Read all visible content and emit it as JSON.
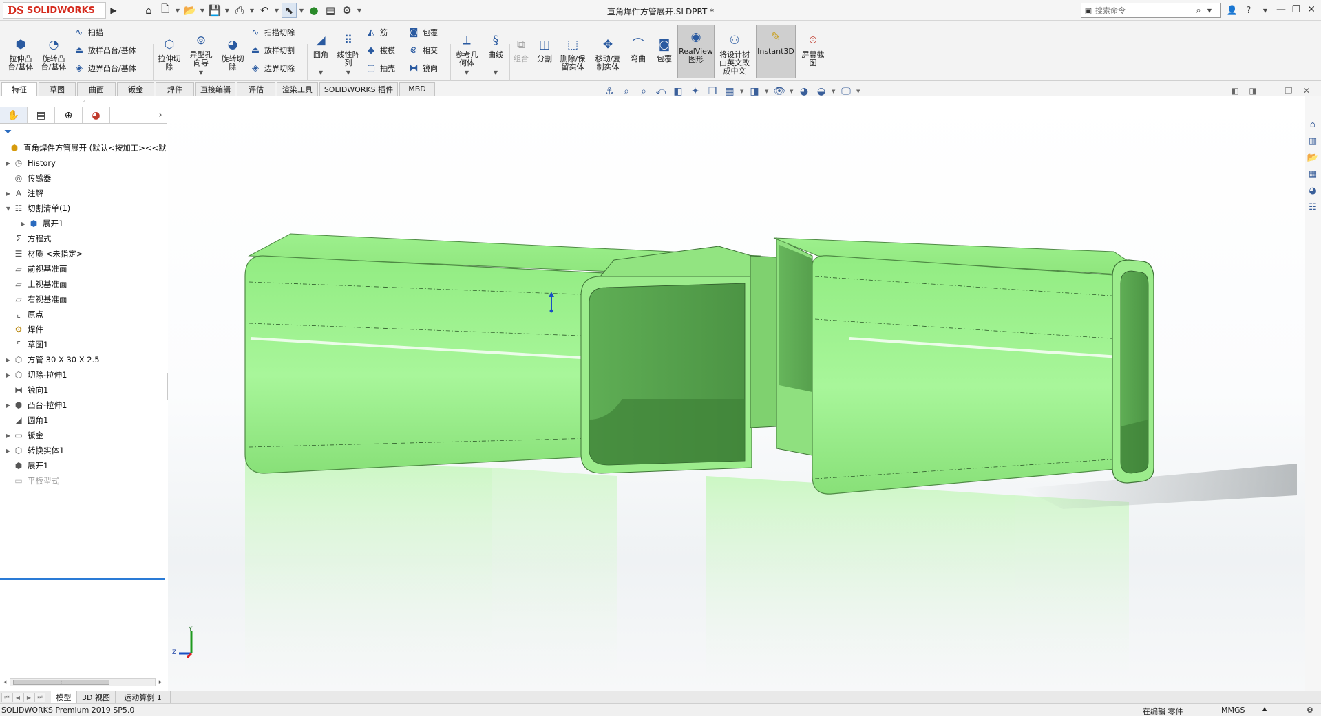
{
  "app": {
    "logo_mark": "DS",
    "logo_text": "SOLIDWORKS",
    "doc_title": "直角焊件方管展开.SLDPRT *"
  },
  "search": {
    "placeholder": "搜索命令"
  },
  "ribbon": {
    "buttons": [
      {
        "label": "拉伸凸\n台/基体"
      },
      {
        "label": "旋转凸\n台/基体"
      },
      {
        "label": "拉伸切\n除"
      },
      {
        "label": "异型孔\n向导"
      },
      {
        "label": "旋转切\n除"
      },
      {
        "label": "圆角"
      },
      {
        "label": "线性阵\n列"
      },
      {
        "label": "参考几\n何体"
      },
      {
        "label": "曲线"
      },
      {
        "label": "组合"
      },
      {
        "label": "分割"
      },
      {
        "label": "删除/保\n留实体"
      },
      {
        "label": "移动/复\n制实体"
      },
      {
        "label": "弯曲"
      },
      {
        "label": "包覆"
      },
      {
        "label": "RealView\n图形"
      },
      {
        "label": "将设计树\n由英文改\n成中文"
      },
      {
        "label": "Instant3D"
      },
      {
        "label": "屏幕截\n图"
      }
    ],
    "small": [
      {
        "label": "扫描"
      },
      {
        "label": "放样凸台/基体"
      },
      {
        "label": "边界凸台/基体"
      },
      {
        "label": "扫描切除"
      },
      {
        "label": "放样切割"
      },
      {
        "label": "边界切除"
      },
      {
        "label": "筋"
      },
      {
        "label": "拔模"
      },
      {
        "label": "抽壳"
      },
      {
        "label": "包覆"
      },
      {
        "label": "相交"
      },
      {
        "label": "镜向"
      }
    ]
  },
  "tabs": [
    "特征",
    "草图",
    "曲面",
    "钣金",
    "焊件",
    "直接编辑",
    "评估",
    "渲染工具",
    "SOLIDWORKS 插件",
    "MBD"
  ],
  "tree": {
    "root": "直角焊件方管展开 (默认<按加工><<默",
    "nodes": [
      {
        "label": "History"
      },
      {
        "label": "传感器"
      },
      {
        "label": "注解"
      },
      {
        "label": "切割清单(1)"
      },
      {
        "label": "展开1"
      },
      {
        "label": "方程式"
      },
      {
        "label": "材质 <未指定>"
      },
      {
        "label": "前视基准面"
      },
      {
        "label": "上视基准面"
      },
      {
        "label": "右视基准面"
      },
      {
        "label": "原点"
      },
      {
        "label": "焊件"
      },
      {
        "label": "草图1"
      },
      {
        "label": "方管 30 X 30 X 2.5"
      },
      {
        "label": "切除-拉伸1"
      },
      {
        "label": "镜向1"
      },
      {
        "label": "凸台-拉伸1"
      },
      {
        "label": "圆角1"
      },
      {
        "label": "钣金"
      },
      {
        "label": "转换实体1"
      },
      {
        "label": "展开1"
      },
      {
        "label": "平板型式"
      }
    ]
  },
  "triad": {
    "y": "Y",
    "z": "Z"
  },
  "bottom_tabs": [
    "模型",
    "3D 视图",
    "运动算例 1"
  ],
  "status": {
    "product": "SOLIDWORKS Premium 2019 SP5.0",
    "mode": "在编辑 零件",
    "units": "MMGS"
  },
  "colors": {
    "part_green": "#9df08d",
    "accent_blue": "#2a7bd6",
    "brand_red": "#d52b1e"
  }
}
